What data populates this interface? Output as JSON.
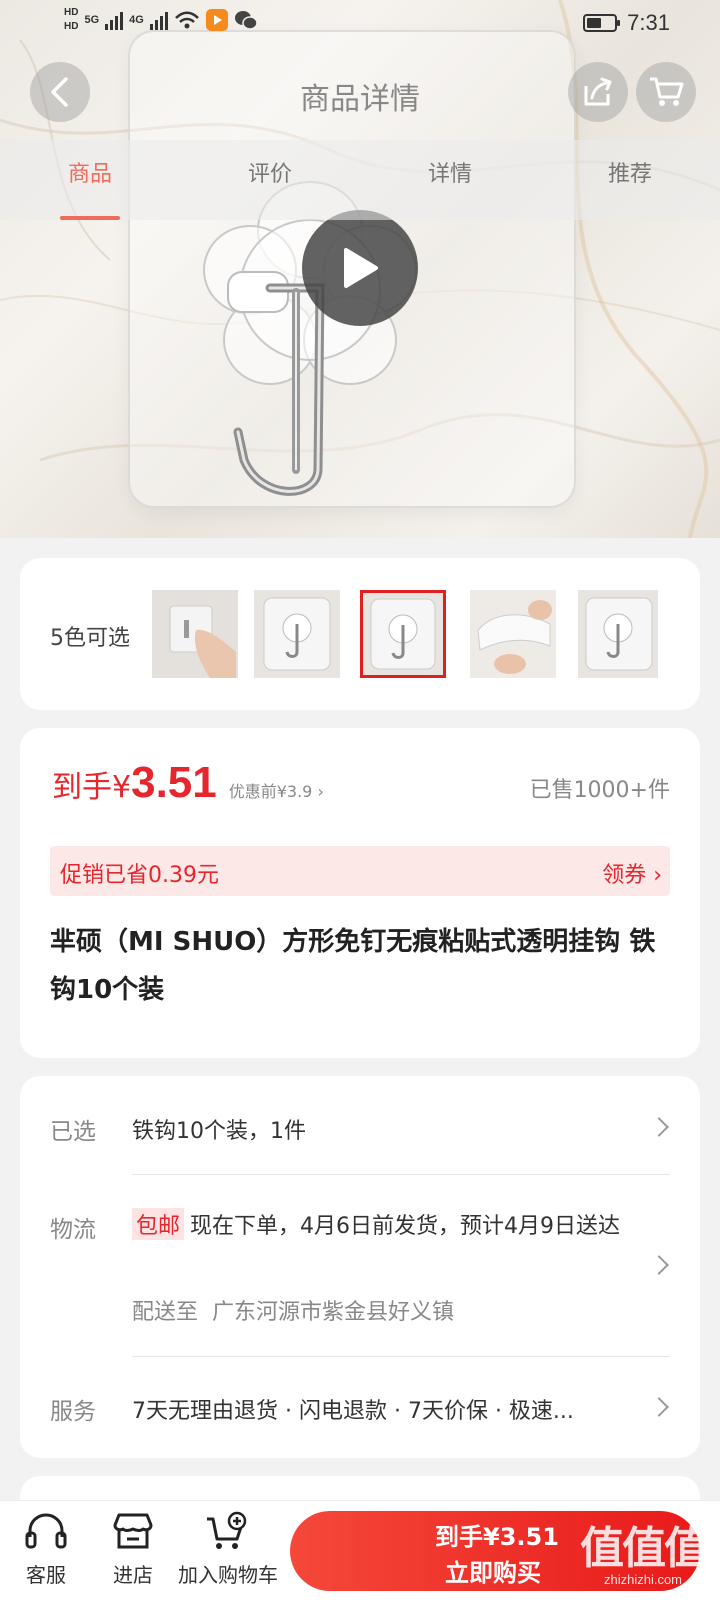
{
  "status_bar": {
    "hd1": "HD",
    "hd2": "HD",
    "net1": "5G",
    "net2": "4G",
    "time": "7:31"
  },
  "nav": {
    "title": "商品详情"
  },
  "tabs": [
    {
      "label": "商品",
      "active": true
    },
    {
      "label": "评价",
      "active": false
    },
    {
      "label": "详情",
      "active": false
    },
    {
      "label": "推荐",
      "active": false
    }
  ],
  "color_selector": {
    "label": "5色可选",
    "selected_index": 2
  },
  "price": {
    "prefix": "到手¥",
    "value": "3.51",
    "before": "优惠前¥3.9 ›",
    "sold": "已售1000+件"
  },
  "promo": {
    "text": "促销已省0.39元",
    "coupon": "领券 ›"
  },
  "product_title": "芈硕（MI SHUO）方形免钉无痕粘贴式透明挂钩 铁钩10个装",
  "info": {
    "selected_label": "已选",
    "selected_value": "铁钩10个装，1件",
    "logistics_label": "物流",
    "free_shipping_tag": "包邮",
    "logistics_value": "现在下单，4月6日前发货，预计4月9日送达",
    "ship_to_label": "配送至",
    "ship_to_value": "广东河源市紫金县好义镇",
    "service_label": "服务",
    "service_value": "7天无理由退货 · 闪电退款 · 7天价保 · 极速..."
  },
  "bottom_bar": {
    "service": "客服",
    "store": "进店",
    "add_cart": "加入购物车",
    "buy_price": "到手¥3.51",
    "buy_now": "立即购买"
  },
  "watermark": {
    "big": "值值值",
    "small": "zhizhizhi.com"
  },
  "colors": {
    "accent_red": "#e5262c",
    "tab_active": "#f06b5b"
  }
}
